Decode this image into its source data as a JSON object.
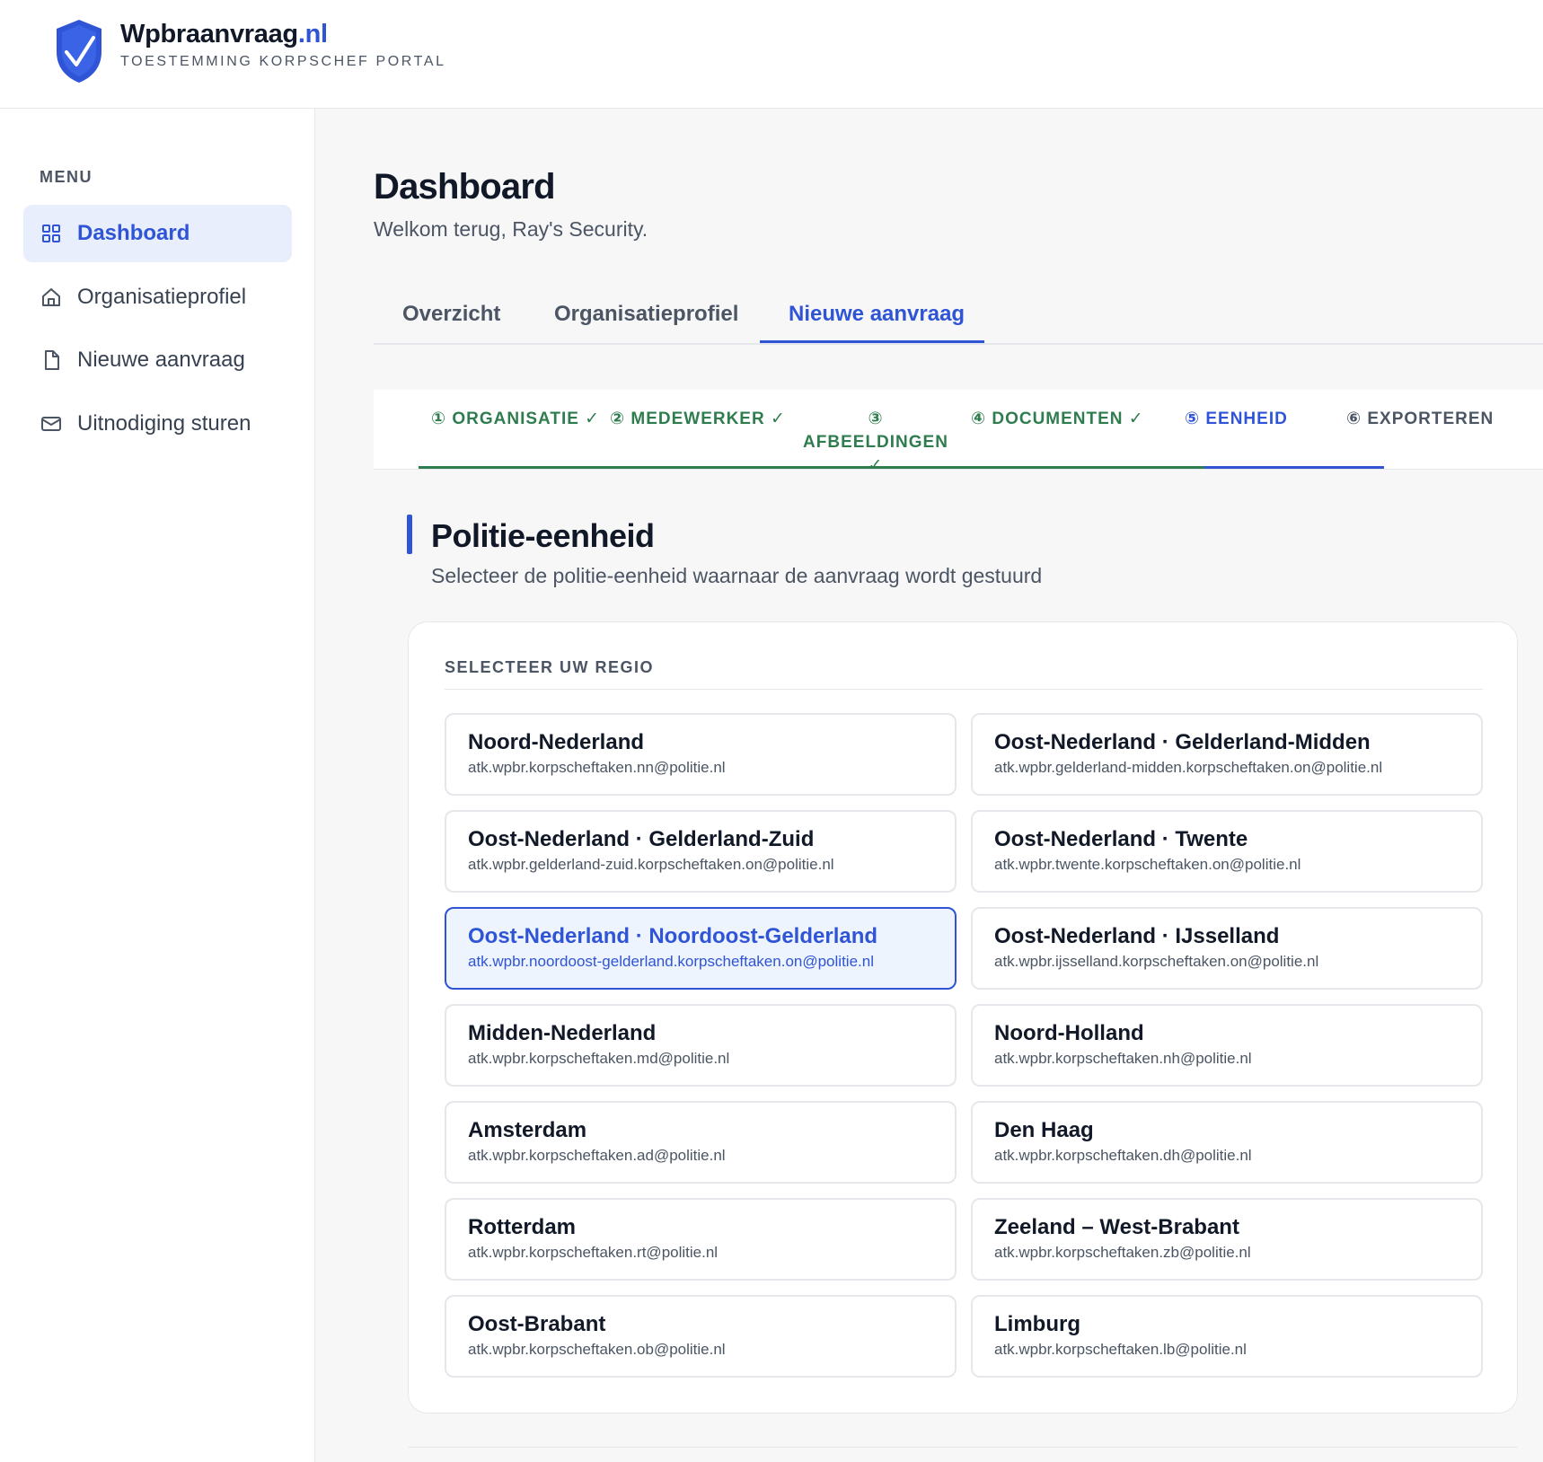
{
  "brand": {
    "name": "Wpbraanvraag",
    "tld": ".nl",
    "subtitle": "TOESTEMMING KORPSCHEF PORTAL",
    "accent": "#2f54d6"
  },
  "sidebar": {
    "menu_label": "MENU",
    "items": [
      {
        "label": "Dashboard",
        "icon": "grid-icon",
        "active": true
      },
      {
        "label": "Organisatieprofiel",
        "icon": "home-icon",
        "active": false
      },
      {
        "label": "Nieuwe aanvraag",
        "icon": "document-icon",
        "active": false
      },
      {
        "label": "Uitnodiging sturen",
        "icon": "mail-icon",
        "active": false
      }
    ]
  },
  "main": {
    "title": "Dashboard",
    "subtitle": "Welkom terug, Ray's Security.",
    "tabs": [
      {
        "label": "Overzicht",
        "active": false
      },
      {
        "label": "Organisatieprofiel",
        "active": false
      },
      {
        "label": "Nieuwe aanvraag",
        "active": true
      }
    ],
    "steps": [
      {
        "label": "① ORGANISATIE ✓",
        "status": "done"
      },
      {
        "label": "② MEDEWERKER ✓",
        "status": "done"
      },
      {
        "label": "③ AFBEELDINGEN",
        "label2": "✓",
        "status": "done"
      },
      {
        "label": "④ DOCUMENTEN ✓",
        "status": "done"
      },
      {
        "label": "⑤ EENHEID",
        "status": "current"
      },
      {
        "label": "⑥ EXPORTEREN",
        "status": "todo"
      }
    ],
    "section": {
      "title": "Politie-eenheid",
      "subtitle": "Selecteer de politie-eenheid waarnaar de aanvraag wordt gestuurd",
      "group_label": "SELECTEER UW REGIO"
    },
    "regions": [
      {
        "name": "Noord-Nederland",
        "email": "atk.wpbr.korpscheftaken.nn@politie.nl"
      },
      {
        "name": "Oost-Nederland · Gelderland-Midden",
        "email": "atk.wpbr.gelderland-midden.korpscheftaken.on@politie.nl"
      },
      {
        "name": "Oost-Nederland · Gelderland-Zuid",
        "email": "atk.wpbr.gelderland-zuid.korpscheftaken.on@politie.nl"
      },
      {
        "name": "Oost-Nederland · Twente",
        "email": "atk.wpbr.twente.korpscheftaken.on@politie.nl"
      },
      {
        "name": "Oost-Nederland · Noordoost-Gelderland",
        "email": "atk.wpbr.noordoost-gelderland.korpscheftaken.on@politie.nl",
        "selected": true
      },
      {
        "name": "Oost-Nederland · IJsselland",
        "email": "atk.wpbr.ijsselland.korpscheftaken.on@politie.nl"
      },
      {
        "name": "Midden-Nederland",
        "email": "atk.wpbr.korpscheftaken.md@politie.nl"
      },
      {
        "name": "Noord-Holland",
        "email": "atk.wpbr.korpscheftaken.nh@politie.nl"
      },
      {
        "name": "Amsterdam",
        "email": "atk.wpbr.korpscheftaken.ad@politie.nl"
      },
      {
        "name": "Den Haag",
        "email": "atk.wpbr.korpscheftaken.dh@politie.nl"
      },
      {
        "name": "Rotterdam",
        "email": "atk.wpbr.korpscheftaken.rt@politie.nl"
      },
      {
        "name": "Zeeland – West-Brabant",
        "email": "atk.wpbr.korpscheftaken.zb@politie.nl"
      },
      {
        "name": "Oost-Brabant",
        "email": "atk.wpbr.korpscheftaken.ob@politie.nl"
      },
      {
        "name": "Limburg",
        "email": "atk.wpbr.korpscheftaken.lb@politie.nl"
      }
    ]
  }
}
